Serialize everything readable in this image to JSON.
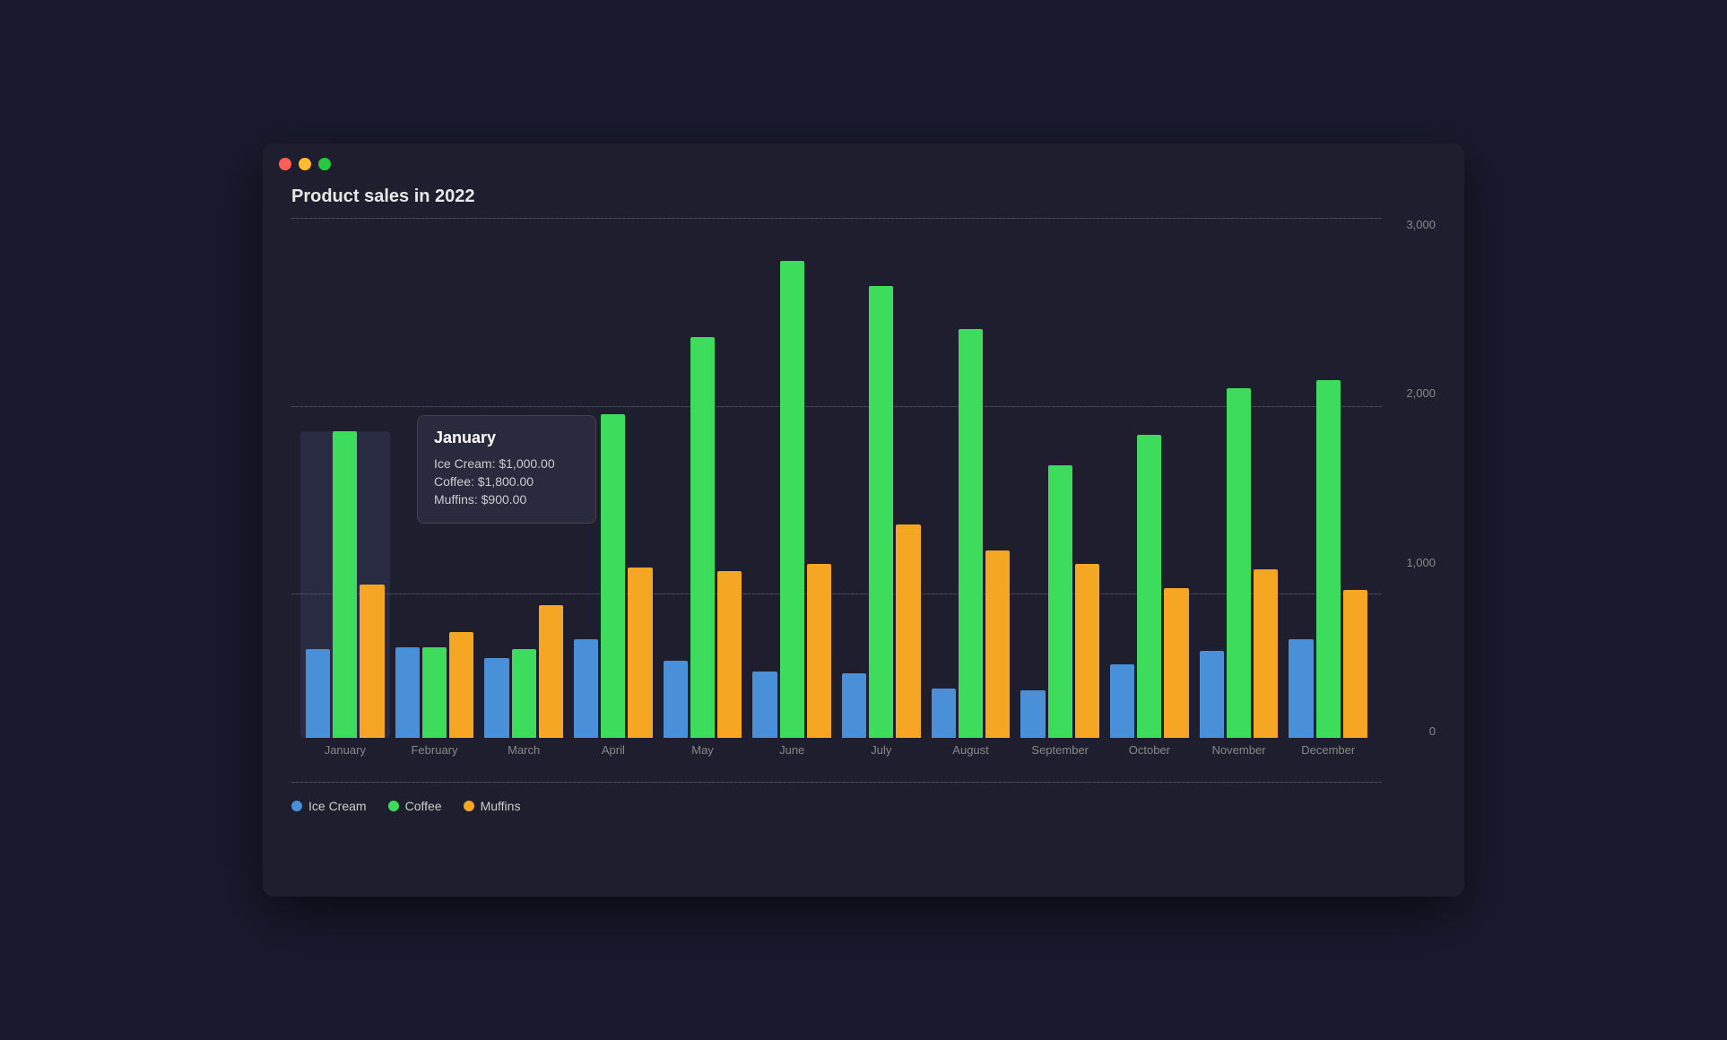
{
  "window": {
    "title": "Product sales in 2022"
  },
  "chart": {
    "title": "Product sales in 2022",
    "y_axis": {
      "max": 3000,
      "labels": [
        "3,000",
        "2,000",
        "1,000",
        "0"
      ]
    },
    "months": [
      {
        "label": "January",
        "icecream": 520,
        "coffee": 1800,
        "muffins": 900,
        "hovered": true
      },
      {
        "label": "February",
        "icecream": 530,
        "coffee": 530,
        "muffins": 620
      },
      {
        "label": "March",
        "icecream": 470,
        "coffee": 520,
        "muffins": 780
      },
      {
        "label": "April",
        "icecream": 580,
        "coffee": 1900,
        "muffins": 1000
      },
      {
        "label": "May",
        "icecream": 450,
        "coffee": 2350,
        "muffins": 980
      },
      {
        "label": "June",
        "icecream": 390,
        "coffee": 2800,
        "muffins": 1020
      },
      {
        "label": "July",
        "icecream": 380,
        "coffee": 2650,
        "muffins": 1250
      },
      {
        "label": "August",
        "icecream": 290,
        "coffee": 2400,
        "muffins": 1100
      },
      {
        "label": "September",
        "icecream": 280,
        "coffee": 1600,
        "muffins": 1020
      },
      {
        "label": "October",
        "icecream": 430,
        "coffee": 1780,
        "muffins": 880
      },
      {
        "label": "November",
        "icecream": 510,
        "coffee": 2050,
        "muffins": 990
      },
      {
        "label": "December",
        "icecream": 580,
        "coffee": 2100,
        "muffins": 870
      }
    ],
    "tooltip": {
      "month": "January",
      "lines": [
        "Ice Cream: $1,000.00",
        "Coffee: $1,800.00",
        "Muffins: $900.00"
      ]
    },
    "legend": [
      {
        "label": "Ice Cream",
        "color": "#4a90d9"
      },
      {
        "label": "Coffee",
        "color": "#3ddc5c"
      },
      {
        "label": "Muffins",
        "color": "#f5a623"
      }
    ]
  }
}
